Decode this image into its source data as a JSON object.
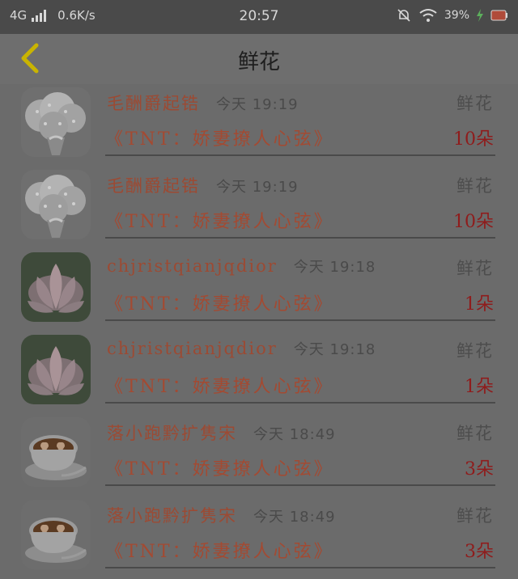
{
  "status_bar": {
    "network": "4G",
    "speed": "0.6K/s",
    "time": "20:57",
    "battery": "39%",
    "icons": [
      "signal-icon",
      "mute-bell-icon",
      "wifi-icon",
      "charging-icon",
      "battery-icon"
    ]
  },
  "header": {
    "title": "鲜花",
    "back_icon": "chevron-left-icon",
    "accent_color": "#c9b400"
  },
  "gifts": [
    {
      "sender": "毛酬爵起锆",
      "time": "今天 19:19",
      "category": "鲜花",
      "message": "《TNT：娇妻撩人心弦》",
      "quantity": "10朵",
      "avatar": "babys-breath-bouquet"
    },
    {
      "sender": "毛酬爵起锆",
      "time": "今天 19:19",
      "category": "鲜花",
      "message": "《TNT：娇妻撩人心弦》",
      "quantity": "10朵",
      "avatar": "babys-breath-bouquet"
    },
    {
      "sender": "chjristqianjqdior",
      "time": "今天 19:18",
      "category": "鲜花",
      "message": "《TNT：娇妻撩人心弦》",
      "quantity": "1朵",
      "avatar": "pink-lotus"
    },
    {
      "sender": "chjristqianjqdior",
      "time": "今天 19:18",
      "category": "鲜花",
      "message": "《TNT：娇妻撩人心弦》",
      "quantity": "1朵",
      "avatar": "pink-lotus"
    },
    {
      "sender": "落小跑黔扩隽宋",
      "time": "今天 18:49",
      "category": "鲜花",
      "message": "《TNT：娇妻撩人心弦》",
      "quantity": "3朵",
      "avatar": "latte-heart-cup"
    },
    {
      "sender": "落小跑黔扩隽宋",
      "time": "今天 18:49",
      "category": "鲜花",
      "message": "《TNT：娇妻撩人心弦》",
      "quantity": "3朵",
      "avatar": "latte-heart-cup"
    }
  ]
}
